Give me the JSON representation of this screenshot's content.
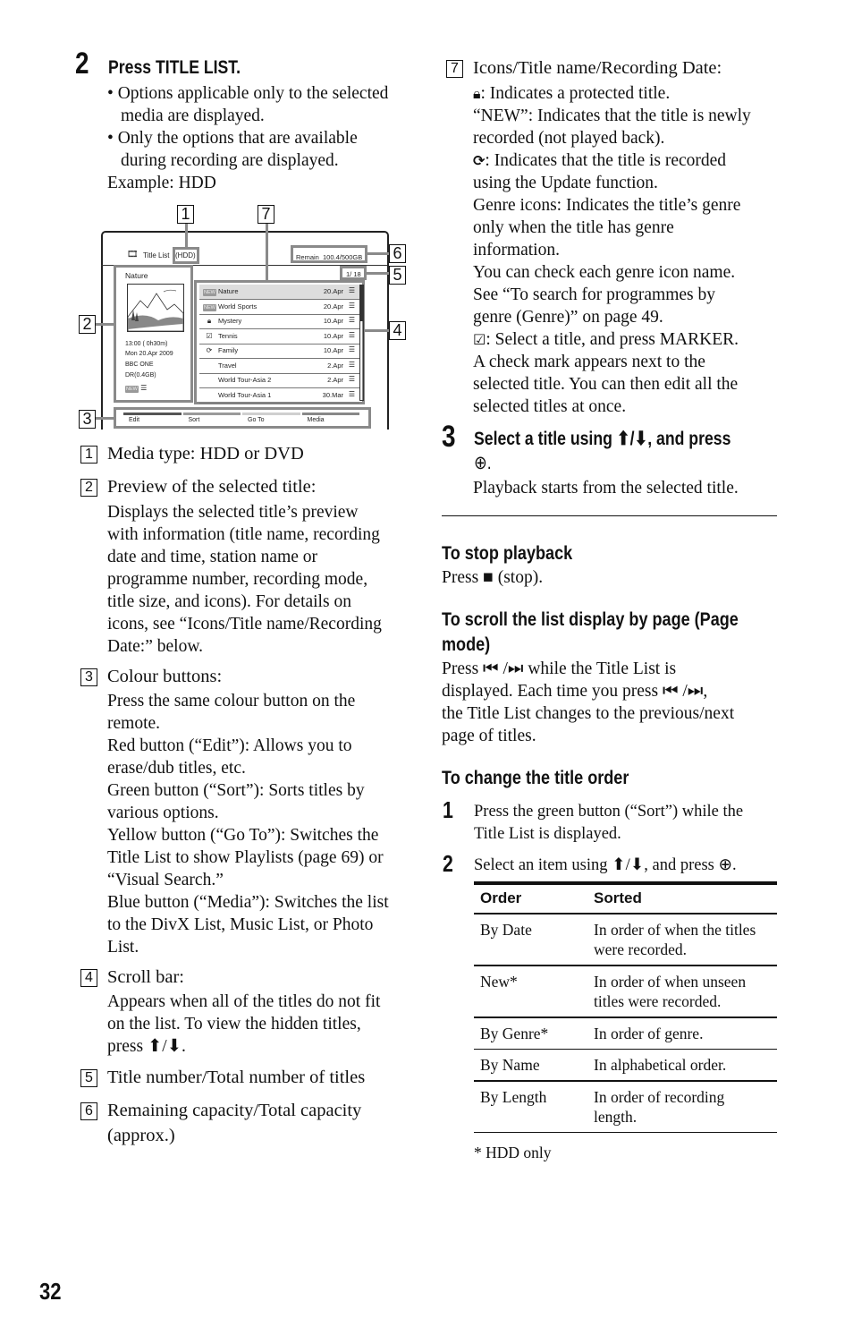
{
  "page_number": "32",
  "step2": {
    "number": "2",
    "heading": "Press TITLE LIST.",
    "bullets": [
      [
        "Options applicable only to the selected",
        "media are displayed."
      ],
      [
        "Only the options that are available",
        "during recording are displayed."
      ]
    ],
    "example": "Example: HDD"
  },
  "screen": {
    "title": "Title List",
    "media": "(HDD)",
    "remain_label": "Remain",
    "remain_value": "100.4/500GB",
    "counter": "1/ 18",
    "preview": {
      "title": "Nature",
      "time": "13:00 ( 0h30m)",
      "date": "Mon 20.Apr 2009",
      "station": "BBC ONE",
      "mode": "DR(0.4GB)",
      "new_tag": "NEW",
      "genre_icon": "☰"
    },
    "rows": [
      {
        "icon": "new",
        "name": "Nature",
        "date": "20.Apr",
        "genre": "☰",
        "selected": true
      },
      {
        "icon": "new",
        "name": "World Sports",
        "date": "20.Apr",
        "genre": "☰",
        "selected": false
      },
      {
        "icon": "lock",
        "name": "Mystery",
        "date": "10.Apr",
        "genre": "☰",
        "selected": false
      },
      {
        "icon": "check",
        "name": "Tennis",
        "date": "10.Apr",
        "genre": "☰",
        "selected": false
      },
      {
        "icon": "update",
        "name": "Family",
        "date": "10.Apr",
        "genre": "☰",
        "selected": false
      },
      {
        "icon": "",
        "name": "Travel",
        "date": "2.Apr",
        "genre": "☰",
        "selected": false
      },
      {
        "icon": "",
        "name": "World Tour-Asia 2",
        "date": "2.Apr",
        "genre": "☰",
        "selected": false
      },
      {
        "icon": "",
        "name": "World Tour-Asia 1",
        "date": "30.Mar",
        "genre": "☰",
        "selected": false
      }
    ],
    "new_tag": "NEW",
    "buttons": [
      {
        "label": "Edit",
        "color": "#555555"
      },
      {
        "label": "Sort",
        "color": "#9a9a9a"
      },
      {
        "label": "Go To",
        "color": "#cfcfcf"
      },
      {
        "label": "Media",
        "color": "#888888"
      }
    ],
    "callouts": [
      "1",
      "2",
      "3",
      "4",
      "5",
      "6",
      "7"
    ]
  },
  "legend": [
    {
      "num": "1",
      "title": "Media type: HDD or DVD",
      "lines": []
    },
    {
      "num": "2",
      "title": "Preview of the selected title:",
      "lines": [
        "Displays the selected title’s preview",
        "with information (title name, recording",
        "date and time, station name or",
        "programme number, recording mode,",
        "title size, and icons). For details on",
        "icons, see “Icons/Title name/Recording",
        "Date:” below."
      ]
    },
    {
      "num": "3",
      "title": "Colour buttons:",
      "lines": [
        "Press the same colour button on the",
        "remote.",
        "Red button (“Edit”): Allows you to",
        "erase/dub titles, etc.",
        "Green button (“Sort”): Sorts titles by",
        "various options.",
        "Yellow button (“Go To”): Switches the",
        "Title List to show Playlists (page 69) or",
        "“Visual Search.”",
        "Blue button (“Media”): Switches the list",
        "to the DivX List, Music List, or Photo",
        "List."
      ]
    },
    {
      "num": "4",
      "title": "Scroll bar:",
      "lines": [
        "Appears when all of the titles do not fit",
        "on the list. To view the hidden titles,",
        "press ⬆/⬇."
      ]
    },
    {
      "num": "5",
      "title": "Title number/Total number of titles",
      "lines": []
    },
    {
      "num": "6",
      "title": "Remaining capacity/Total capacity",
      "lines": [
        "(approx.)"
      ]
    },
    {
      "num": "7",
      "title": "Icons/Title name/Recording Date:",
      "lines": [
        ": Indicates a protected title.",
        "“NEW”: Indicates that the title is newly",
        "recorded (not played back).",
        ": Indicates that the title is recorded",
        "using the Update function.",
        "Genre icons: Indicates the title’s genre",
        "only when the title has genre",
        "information.",
        "You can check each genre icon name.",
        "See “To search for programmes by",
        "genre (Genre)” on page 49.",
        ": Select a title, and press MARKER.",
        "A check mark appears next to the",
        "selected title. You can then edit all the",
        "selected titles at once."
      ]
    }
  ],
  "step3": {
    "number": "3",
    "heading_line1": "Select a title using ⬆/⬇, and press",
    "heading_line2": "⊕.",
    "body": "Playback starts from the selected title."
  },
  "stop": {
    "heading": "To stop playback",
    "body": "Press ■ (stop)."
  },
  "page_mode": {
    "heading_line1": "To scroll the list display by page (Page",
    "heading_line2": "mode)",
    "lines": [
      "Press ⏮ /⏭ while the Title List is",
      "displayed. Each time you press ⏮ /⏭,",
      "the Title List changes to the previous/next",
      "page of titles."
    ]
  },
  "title_order": {
    "heading": "To change the title order",
    "steps": [
      {
        "num": "1",
        "lines": [
          "Press the green button (“Sort”) while the",
          "Title List is displayed."
        ]
      },
      {
        "num": "2",
        "lines": [
          "Select an item using ⬆/⬇, and press ⊕."
        ]
      }
    ],
    "table": {
      "headers": [
        "Order",
        "Sorted"
      ],
      "rows": [
        [
          "By Date",
          "In order of when the titles",
          "were recorded."
        ],
        [
          "New*",
          "In order of when unseen",
          "titles were recorded."
        ],
        [
          "By Genre*",
          "In order of genre.",
          ""
        ],
        [
          "By Name",
          "In alphabetical order.",
          ""
        ],
        [
          "By Length",
          "In order of recording",
          "length."
        ]
      ]
    },
    "footnote": "* HDD only"
  }
}
